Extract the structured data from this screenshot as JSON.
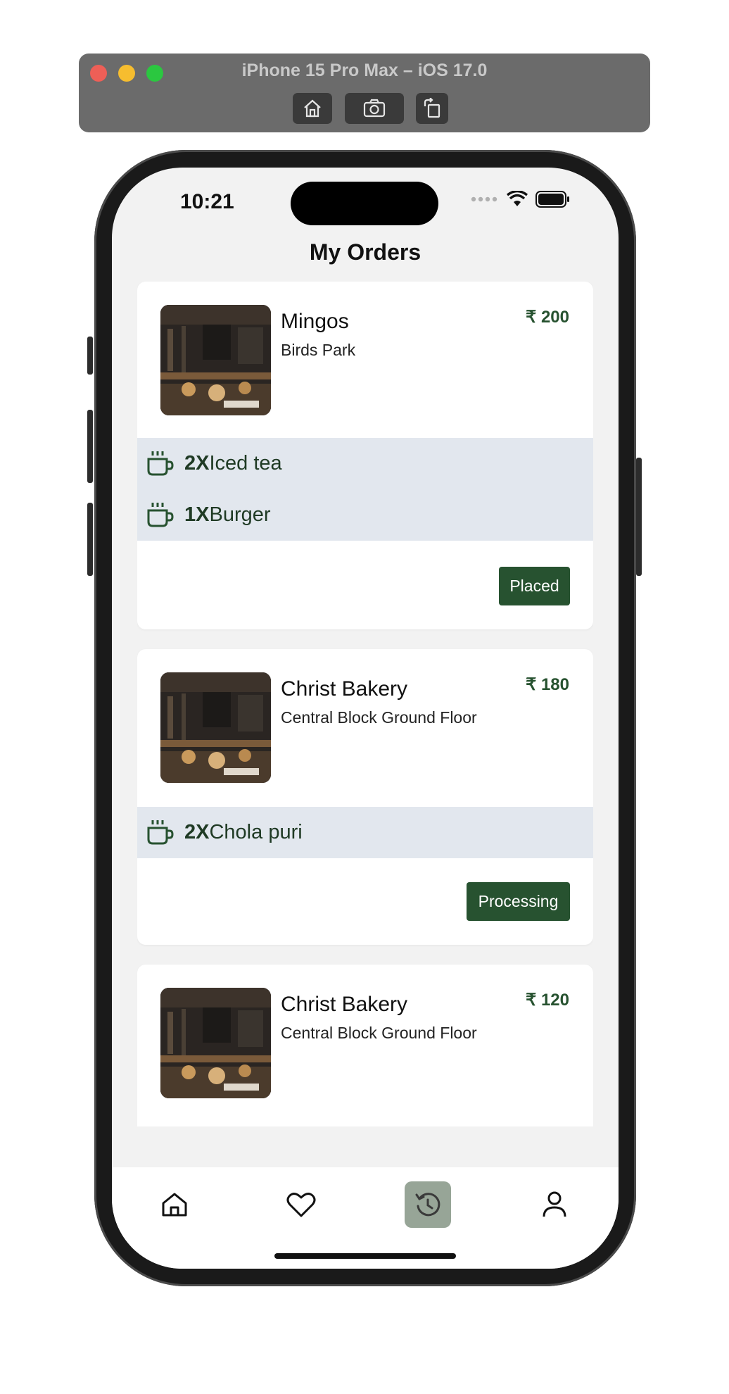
{
  "simulator": {
    "title": "iPhone 15 Pro Max – iOS 17.0",
    "buttons": [
      "home-icon",
      "screenshot-icon",
      "rotate-icon"
    ]
  },
  "status_bar": {
    "time": "10:21"
  },
  "page": {
    "title": "My Orders"
  },
  "orders": [
    {
      "vendor": "Mingos",
      "location": "Birds Park",
      "price": "₹ 200",
      "items": [
        {
          "qty": "2X",
          "name": "Iced tea"
        },
        {
          "qty": "1X",
          "name": "Burger"
        }
      ],
      "status": "Placed"
    },
    {
      "vendor": "Christ Bakery",
      "location": "Central Block Ground Floor",
      "price": "₹ 180",
      "items": [
        {
          "qty": "2X",
          "name": "Chola puri"
        }
      ],
      "status": "Processing"
    },
    {
      "vendor": "Christ Bakery",
      "location": "Central Block Ground Floor",
      "price": "₹ 120",
      "items": [],
      "status": ""
    }
  ],
  "tabs": [
    {
      "icon": "home-icon",
      "active": false
    },
    {
      "icon": "heart-icon",
      "active": false
    },
    {
      "icon": "history-icon",
      "active": true
    },
    {
      "icon": "profile-icon",
      "active": false
    }
  ],
  "colors": {
    "accent": "#275230",
    "item_band": "#e2e7ee",
    "active_tab": "#97a597",
    "screen_bg": "#f2f2f2"
  }
}
